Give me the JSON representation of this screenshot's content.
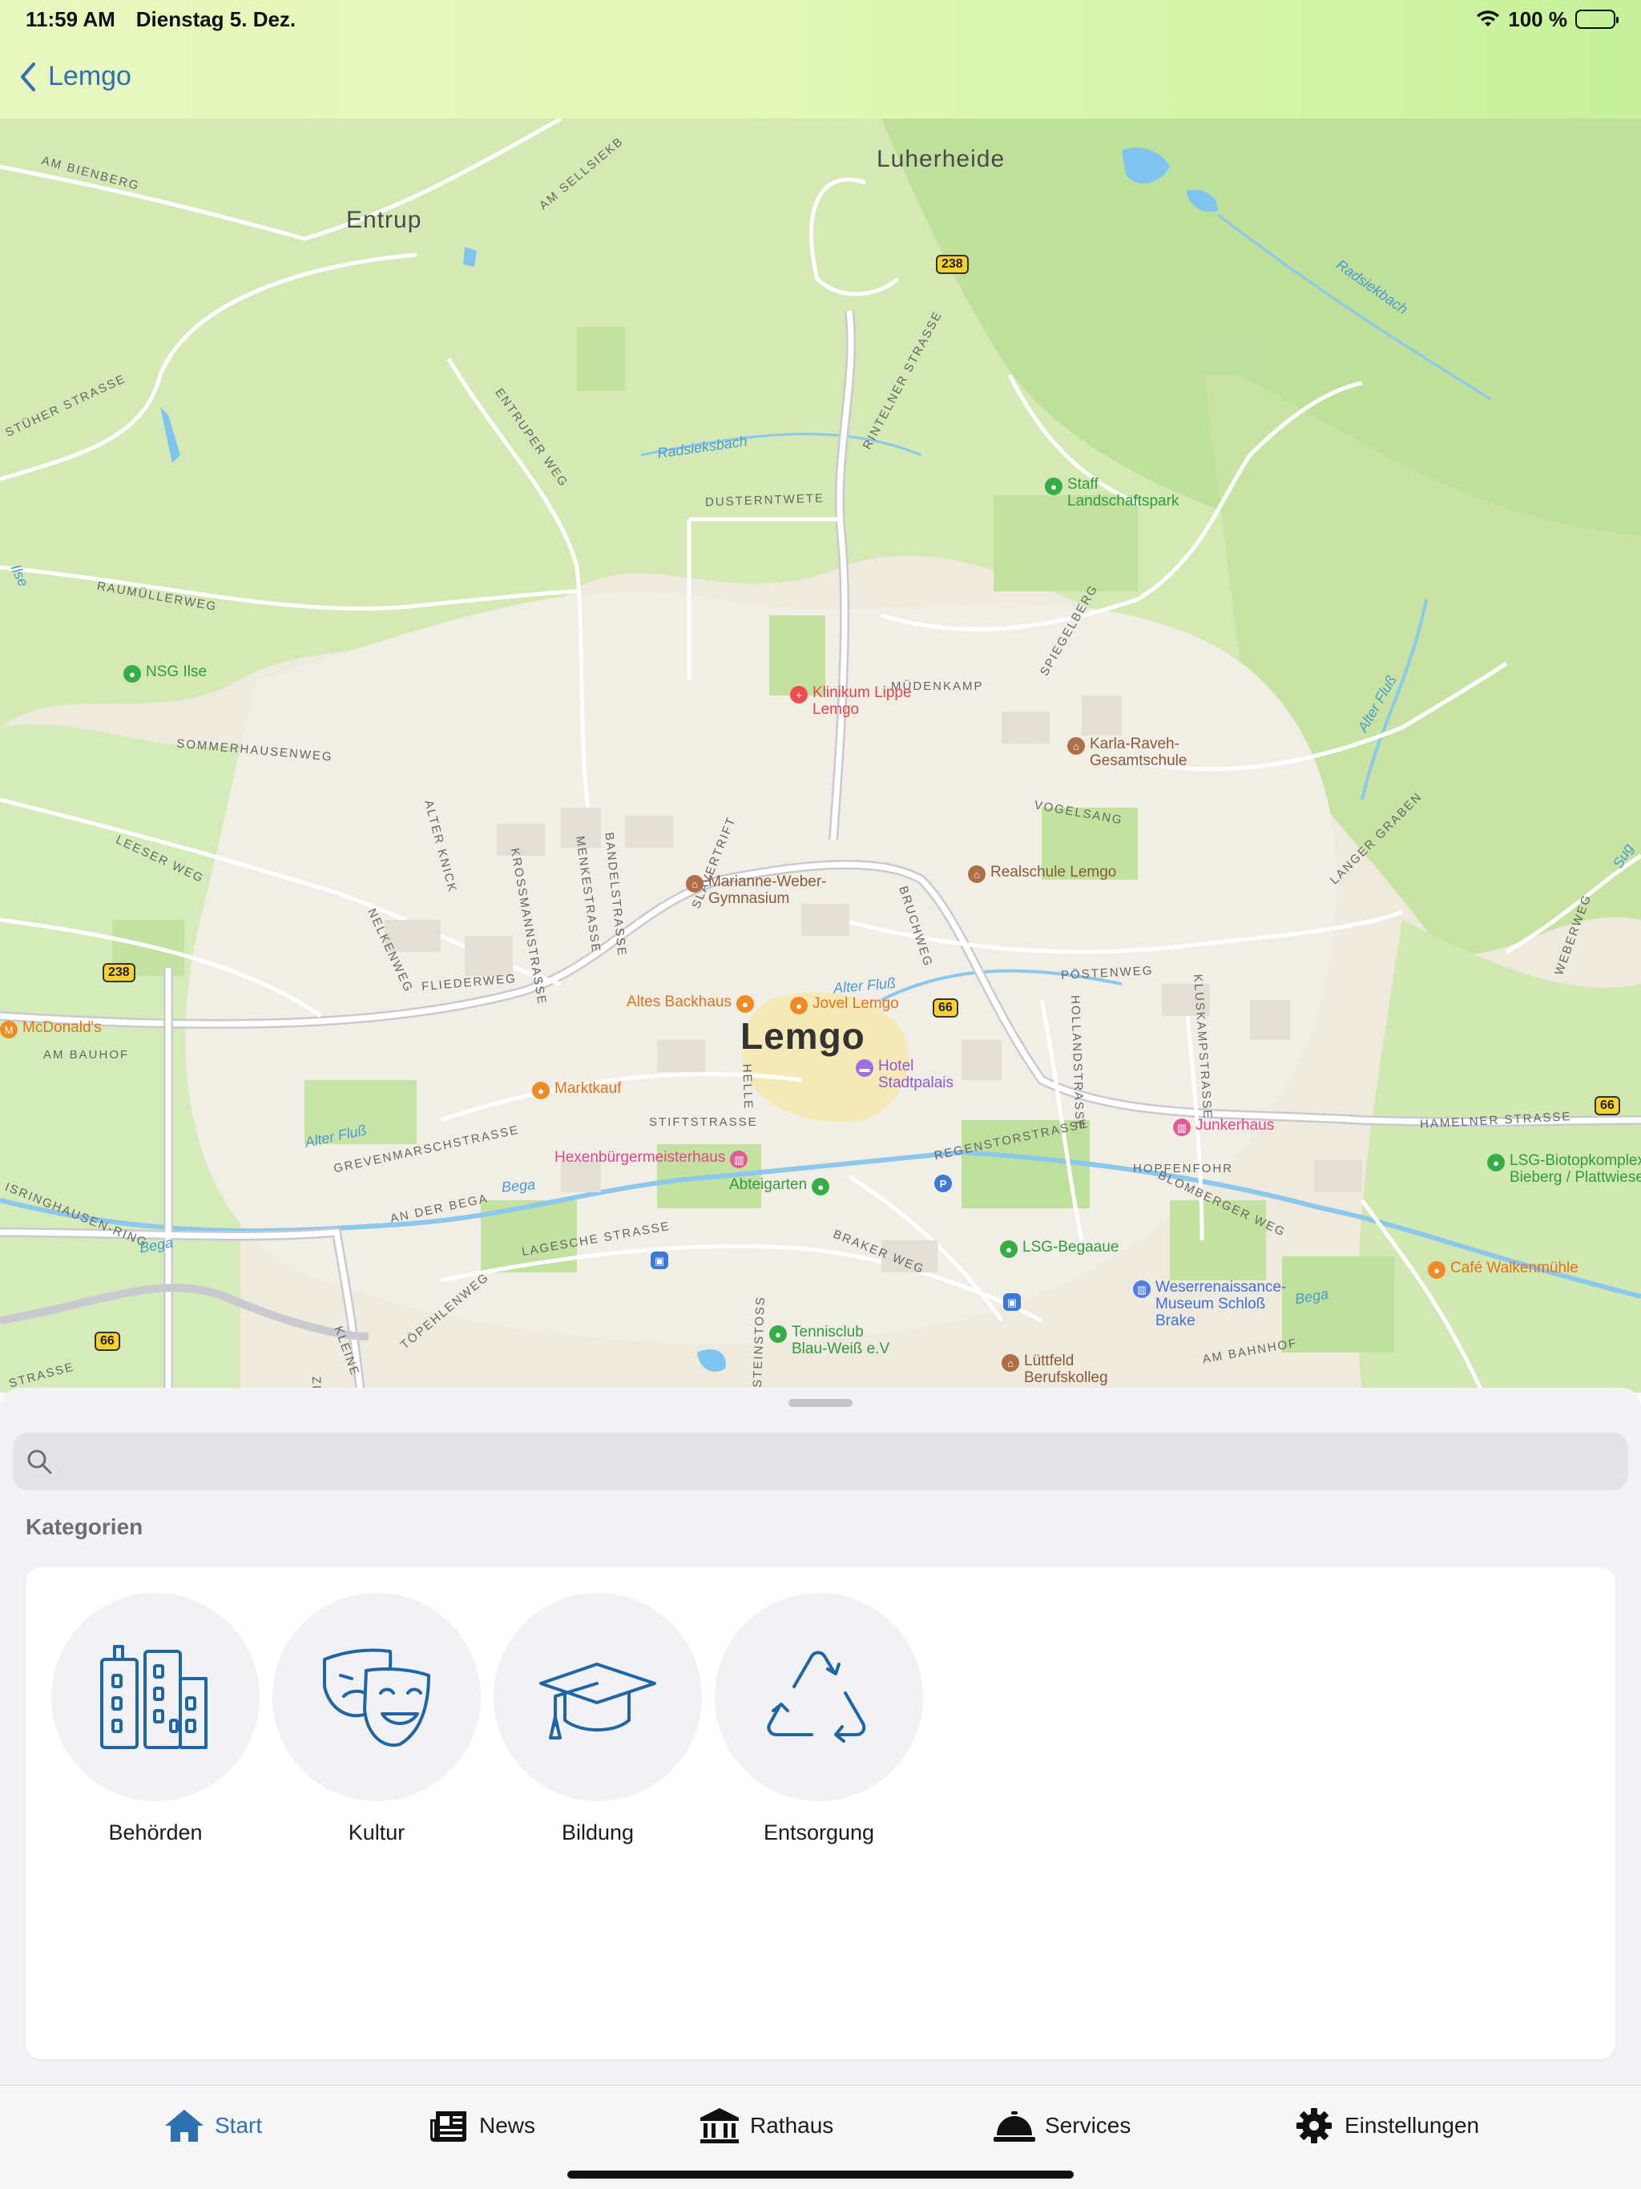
{
  "status_bar": {
    "time": "11:59 AM",
    "date": "Dienstag 5. Dez.",
    "battery": "100 %"
  },
  "nav": {
    "back_label": "Lemgo"
  },
  "map": {
    "towns": [
      "Luherheide",
      "Entrup",
      "Lemgo"
    ],
    "streets": [
      "AM BIENBERG",
      "AM SELLSIEKB",
      "STÜHER STRASSE",
      "ENTRUPER WEG",
      "RINTELNER STRASSE",
      "DUSTERNTWETE",
      "RAUMÜLLERWEG",
      "SOMMERHAUSENWEG",
      "LEESER WEG",
      "ALTER KNICK",
      "KROSSMANNSTRASSE",
      "MENKESTRASSE",
      "BANDELSTRASSE",
      "SLAVERTRIFT",
      "MÜDENKAMP",
      "SPIEGELBERG",
      "VOGELSANG",
      "LANGER GRABEN",
      "NELKENWEG",
      "FLIEDERWEG",
      "BRUCHWEG",
      "PÖSTENWEG",
      "HOLLANDSTRASSE",
      "KLUSKAMPSTRASSE",
      "HAMELNER STRASSE",
      "WEBERWEG",
      "AM BAUHOF",
      "STIFTSTRASSE",
      "HELLE",
      "GREVENMARSCHSTRASSE",
      "REGENSTORSTRASSE",
      "HOPFENFOHR",
      "BLOMBERGER WEG",
      "AN DER BEGA",
      "LAGESCHE STRASSE",
      "BRAKER WEG",
      "TÖPEHLENWEG",
      "STEINSTOSS",
      "AM BAHNHOF",
      "ISRINGHAUSEN-RING",
      "STRASSE",
      "KLEINE",
      "ZI"
    ],
    "waters": [
      "Radsiekbach",
      "Radsieksbach",
      "Ilse",
      "Alter Fluß",
      "Alter Fluß",
      "Alter Fluß",
      "Bega",
      "Bega",
      "Bega",
      "Sug"
    ],
    "shields": [
      "238",
      "238",
      "66",
      "66",
      "66"
    ],
    "pois": [
      {
        "name": "Staff Landschaftspark",
        "kind": "green"
      },
      {
        "name": "NSG Ilse",
        "kind": "green"
      },
      {
        "name": "Klinikum Lippe Lemgo",
        "kind": "red"
      },
      {
        "name": "Karla-Raveh-Gesamtschule",
        "kind": "brown"
      },
      {
        "name": "Realschule Lemgo",
        "kind": "brown"
      },
      {
        "name": "Marianne-Weber-Gymnasium",
        "kind": "brown"
      },
      {
        "name": "McDonald's",
        "kind": "orange"
      },
      {
        "name": "Altes Backhaus",
        "kind": "orange"
      },
      {
        "name": "Jovel Lemgo",
        "kind": "orange"
      },
      {
        "name": "Hotel Stadtpalais",
        "kind": "purple"
      },
      {
        "name": "Marktkauf",
        "kind": "orange"
      },
      {
        "name": "Junkerhaus",
        "kind": "pink"
      },
      {
        "name": "Hexenbürgermeisterhaus",
        "kind": "pink"
      },
      {
        "name": "Abteigarten",
        "kind": "green"
      },
      {
        "name": "LSG-Biotopkomplex Bieberg / Plattwiese",
        "kind": "green"
      },
      {
        "name": "LSG-Begaaue",
        "kind": "green"
      },
      {
        "name": "Weserrenaissance-Museum Schloß Brake",
        "kind": "blue"
      },
      {
        "name": "Café Walkenmühle",
        "kind": "orange"
      },
      {
        "name": "Tennisclub Blau-Weiß e.V",
        "kind": "green"
      },
      {
        "name": "Lüttfeld Berufskolleg",
        "kind": "brown"
      }
    ]
  },
  "search": {
    "placeholder": "",
    "value": ""
  },
  "categories": {
    "title": "Kategorien",
    "items": [
      {
        "label": "Behörden",
        "icon": "buildings-icon"
      },
      {
        "label": "Kultur",
        "icon": "theater-masks-icon"
      },
      {
        "label": "Bildung",
        "icon": "graduation-cap-icon"
      },
      {
        "label": "Entsorgung",
        "icon": "recycle-icon"
      }
    ]
  },
  "tabs": [
    {
      "label": "Start",
      "icon": "house-icon",
      "active": true
    },
    {
      "label": "News",
      "icon": "newspaper-icon",
      "active": false
    },
    {
      "label": "Rathaus",
      "icon": "townhall-icon",
      "active": false
    },
    {
      "label": "Services",
      "icon": "service-bell-icon",
      "active": false
    },
    {
      "label": "Einstellungen",
      "icon": "gear-icon",
      "active": false
    }
  ],
  "colors": {
    "accent": "#2f6fb3",
    "nav_gradient_start": "#e8f7bf",
    "nav_gradient_end": "#c5f19a",
    "map_base": "#eeeadd",
    "map_green": "#c9e4a6"
  }
}
